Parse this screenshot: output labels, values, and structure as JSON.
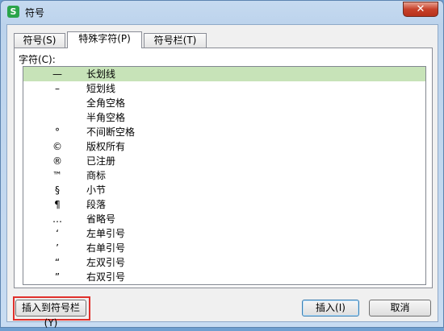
{
  "window": {
    "title": "符号",
    "app_icon_letter": "S",
    "close_glyph": "✕",
    "accent_close": "#c7412a"
  },
  "tabs": [
    {
      "label": "符号(S)",
      "active": false
    },
    {
      "label": "特殊字符(P)",
      "active": true
    },
    {
      "label": "符号栏(T)",
      "active": false
    }
  ],
  "panel": {
    "group_label": "字符(C):",
    "selected_color": "#c7e3b8",
    "items": [
      {
        "symbol": "—",
        "name": "长划线"
      },
      {
        "symbol": "–",
        "name": "短划线"
      },
      {
        "symbol": "",
        "name": "全角空格"
      },
      {
        "symbol": "",
        "name": "半角空格"
      },
      {
        "symbol": "°",
        "name": "不间断空格"
      },
      {
        "symbol": "©",
        "name": "版权所有"
      },
      {
        "symbol": "®",
        "name": "已注册"
      },
      {
        "symbol": "™",
        "name": "商标"
      },
      {
        "symbol": "§",
        "name": "小节"
      },
      {
        "symbol": "¶",
        "name": "段落"
      },
      {
        "symbol": "…",
        "name": "省略号"
      },
      {
        "symbol": "‘",
        "name": "左单引号"
      },
      {
        "symbol": "’",
        "name": "右单引号"
      },
      {
        "symbol": "“",
        "name": "左双引号"
      },
      {
        "symbol": "”",
        "name": "右双引号"
      }
    ],
    "selected_index": 0
  },
  "footer": {
    "insert_to_bar_label": "插入到符号栏(Y)",
    "insert_label": "插入(I)",
    "cancel_label": "取消",
    "highlight_color": "#e0302b"
  }
}
